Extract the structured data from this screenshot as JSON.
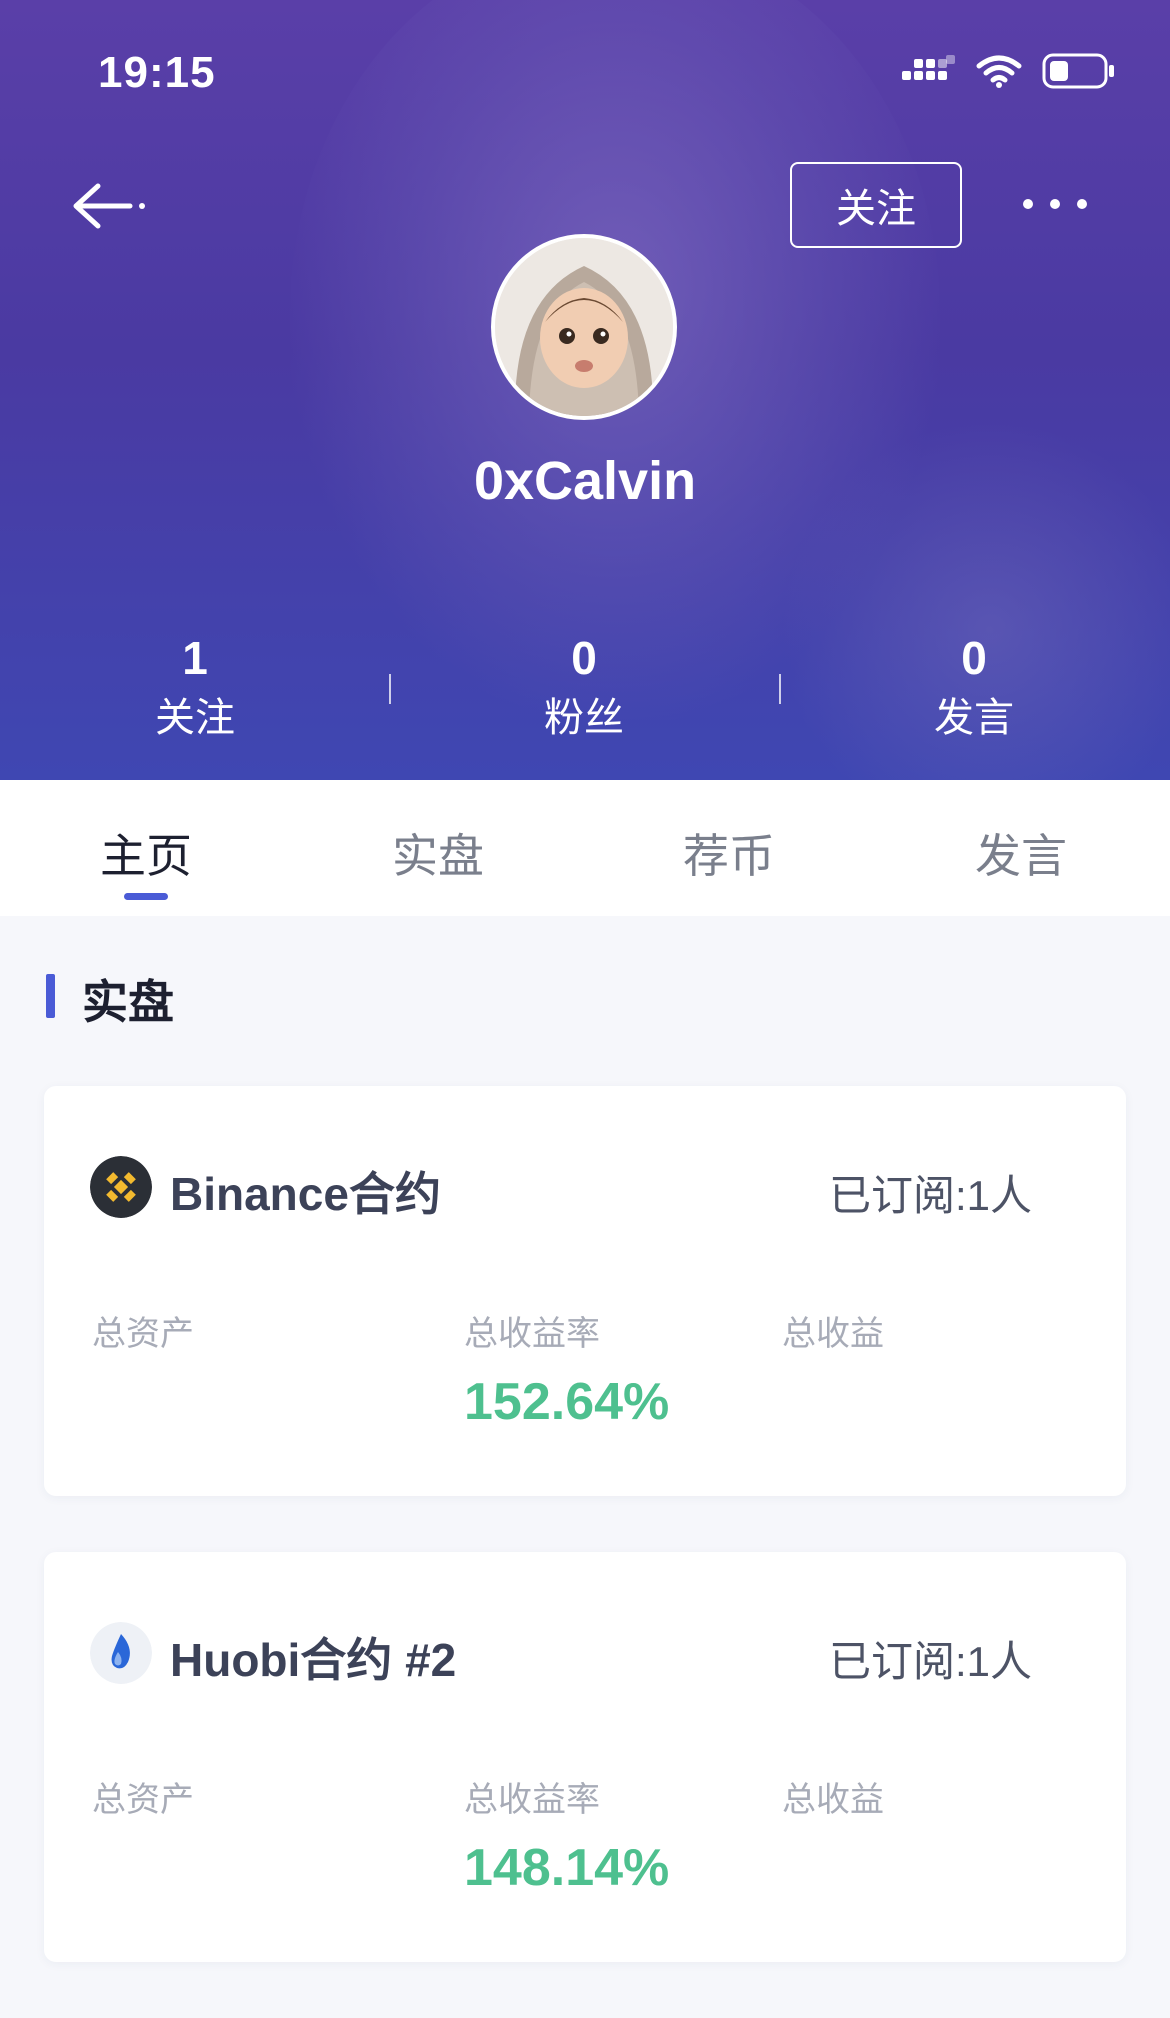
{
  "status_bar": {
    "time": "19:15"
  },
  "header": {
    "follow_button": "关注",
    "username": "0xCalvin",
    "stats": [
      {
        "value": "1",
        "label": "关注"
      },
      {
        "value": "0",
        "label": "粉丝"
      },
      {
        "value": "0",
        "label": "发言"
      }
    ]
  },
  "tabs": [
    {
      "label": "主页",
      "active": true
    },
    {
      "label": "实盘",
      "active": false
    },
    {
      "label": "荐币",
      "active": false
    },
    {
      "label": "发言",
      "active": false
    }
  ],
  "section": {
    "title": "实盘"
  },
  "accounts": [
    {
      "exchange": "Binance合约",
      "icon": "binance-icon",
      "subscribers": "已订阅:1人",
      "labels": {
        "total_assets": "总资产",
        "total_return_rate": "总收益率",
        "total_profit": "总收益"
      },
      "total_return_rate": "152.64%"
    },
    {
      "exchange": "Huobi合约 #2",
      "icon": "huobi-icon",
      "subscribers": "已订阅:1人",
      "labels": {
        "total_assets": "总资产",
        "total_return_rate": "总收益率",
        "total_profit": "总收益"
      },
      "total_return_rate": "148.14%"
    }
  ],
  "colors": {
    "header_gradient_top": "#5a3fa8",
    "header_gradient_bottom": "#3f47b2",
    "accent": "#4a5bd6",
    "positive": "#4ec08f",
    "binance_yellow": "#f3ba2f"
  }
}
